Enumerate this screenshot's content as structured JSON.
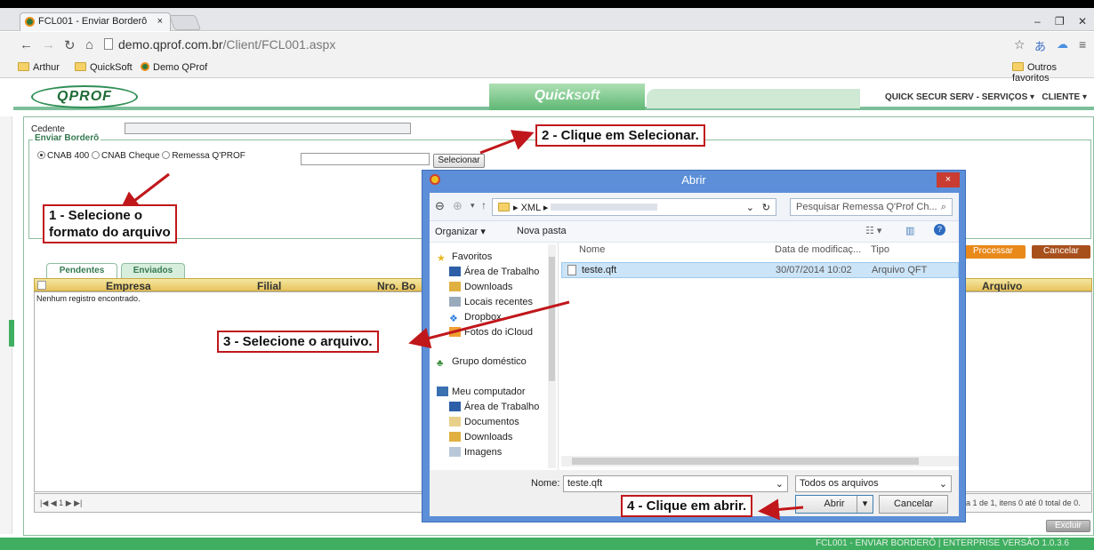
{
  "browser": {
    "tab_title": "FCL001 - Enviar Borderô",
    "tab_close": "×",
    "url_host": "demo.qprof.com.br",
    "url_path": "/Client/FCL001.aspx",
    "bookmarks": [
      "Arthur",
      "QuickSoft",
      "Demo QProf"
    ],
    "other_bookmarks": "Outros favoritos"
  },
  "app": {
    "logo": "QPROF",
    "brand_quick": "Quick",
    "brand_soft": "soft",
    "company_menu": "QUICK SECUR SERV - SERVIÇOS",
    "client_menu": "CLIENTE",
    "footer": "FCL001 - ENVIAR BORDERÔ | ENTERPRISE VERSÃO 1.0.3.6"
  },
  "form": {
    "cedente_label": "Cedente",
    "section_legend": "Enviar Borderô",
    "radio_options": [
      "CNAB 400",
      "CNAB Cheque",
      "Remessa Q'PROF"
    ],
    "select_button": "Selecionar",
    "process_button": "Processar",
    "cancel_button": "Cancelar"
  },
  "grid": {
    "tabs": [
      "Pendentes",
      "Enviados"
    ],
    "columns": [
      "Empresa",
      "Filial",
      "Nro. Bo",
      "Arquivo"
    ],
    "empty_message": "Nenhum registro encontrado.",
    "pager": "|◀ ◀ 1 ▶ ▶|",
    "pager_info": "a 1 de 1, itens 0 até 0 total de 0.",
    "delete_button": "Excluir"
  },
  "annotations": {
    "step1": "1 - Selecione o",
    "step1b": "formato do arquivo",
    "step2": "2 - Clique em Selecionar.",
    "step3": "3 - Selecione o arquivo.",
    "step4": "4 - Clique em abrir."
  },
  "dialog": {
    "title": "Abrir",
    "close": "×",
    "path_folder": "XML",
    "search_placeholder": "Pesquisar Remessa Q'Prof Ch...",
    "organize": "Organizar ▾",
    "new_folder": "Nova pasta",
    "tree": [
      "Favoritos",
      "Área de Trabalho",
      "Downloads",
      "Locais recentes",
      "Dropbox",
      "Fotos do iCloud",
      "Grupo doméstico",
      "Meu computador",
      "Área de Trabalho",
      "Documentos",
      "Downloads",
      "Imagens"
    ],
    "columns": [
      "Nome",
      "Data de modificaç...",
      "Tipo"
    ],
    "file": {
      "name": "teste.qft",
      "date": "30/07/2014 10:02",
      "type": "Arquivo QFT"
    },
    "name_label": "Nome:",
    "name_value": "teste.qft",
    "filter_value": "Todos os arquivos",
    "open_button": "Abrir",
    "cancel_button": "Cancelar"
  },
  "colors": {
    "brand_green": "#3fae60",
    "annotation_red": "#c0171b",
    "dialog_blue": "#5c8fd8",
    "orange_button": "#e8891a",
    "brown_button": "#a8501c"
  }
}
